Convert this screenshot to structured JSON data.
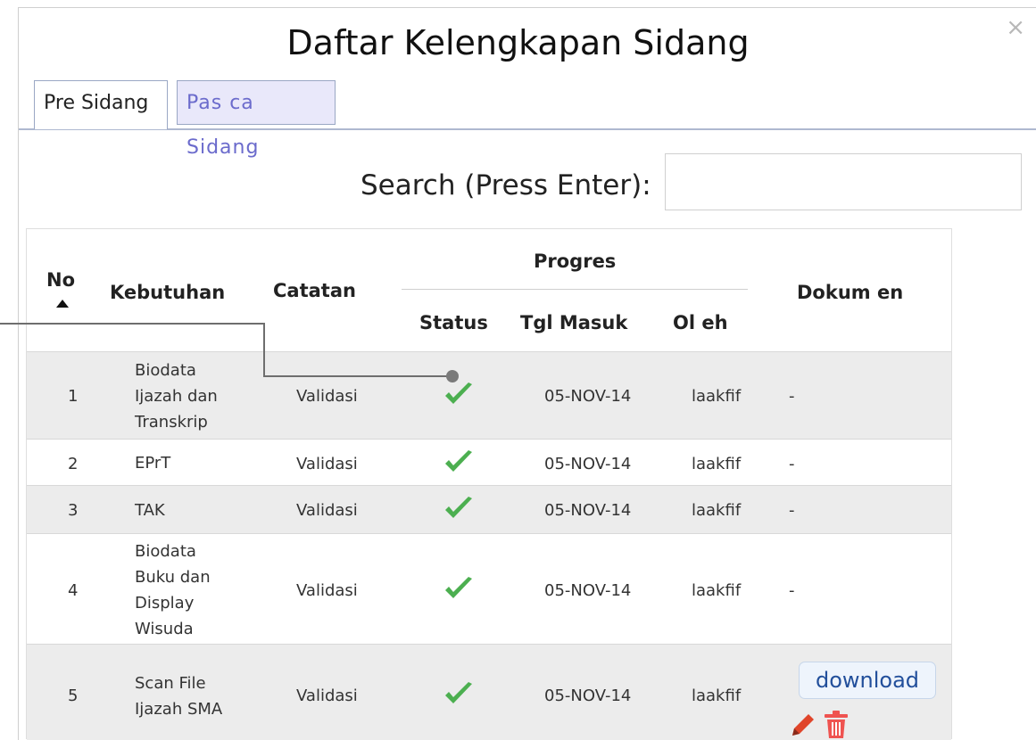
{
  "dialog": {
    "title": "Daftar Kelengkapan Sidang",
    "close_label": "×"
  },
  "tabs": [
    {
      "label": "Pre Sidang",
      "active": true
    },
    {
      "label": "Pas ca Sidang",
      "active": false
    }
  ],
  "search": {
    "label": "Search (Press Enter):",
    "value": ""
  },
  "table": {
    "headers": {
      "no": "No",
      "kebutuhan": "Kebutuhan",
      "catatan": "Catatan",
      "progres": "Progres",
      "status": "Status",
      "tgl_masuk": "Tgl Masuk",
      "oleh": "Ol eh",
      "dokumen": "Dokum en"
    },
    "rows": [
      {
        "no": "1",
        "kebutuhan": [
          "Biodata",
          "Ijazah dan",
          "Transkrip"
        ],
        "catatan": "Validasi",
        "status": "check",
        "tgl_masuk": "05-NOV-14",
        "oleh": "laakfif",
        "dokumen": "-"
      },
      {
        "no": "2",
        "kebutuhan": [
          "EPrT"
        ],
        "catatan": "Validasi",
        "status": "check",
        "tgl_masuk": "05-NOV-14",
        "oleh": "laakfif",
        "dokumen": "-"
      },
      {
        "no": "3",
        "kebutuhan": [
          "TAK"
        ],
        "catatan": "Validasi",
        "status": "check",
        "tgl_masuk": "05-NOV-14",
        "oleh": "laakfif",
        "dokumen": "-"
      },
      {
        "no": "4",
        "kebutuhan": [
          "Biodata",
          "Buku dan",
          "Display",
          "Wisuda"
        ],
        "catatan": "Validasi",
        "status": "check",
        "tgl_masuk": "05-NOV-14",
        "oleh": "laakfif",
        "dokumen": "-"
      },
      {
        "no": "5",
        "kebutuhan": [
          "Scan File",
          "Ijazah SMA"
        ],
        "catatan": "Validasi",
        "status": "check",
        "tgl_masuk": "05-NOV-14",
        "oleh": "laakfif",
        "dokumen": "download"
      }
    ]
  },
  "icons": {
    "check": "check-icon",
    "sort": "sort-asc-icon",
    "edit": "pencil-icon",
    "delete": "trash-icon"
  },
  "colors": {
    "check": "#4caf50",
    "tab_inactive_bg": "#e9e8fa",
    "row_alt": "#ececec",
    "download_text": "#224f9b",
    "edit_icon": "#e0452a",
    "trash_icon": "#ef5350"
  }
}
